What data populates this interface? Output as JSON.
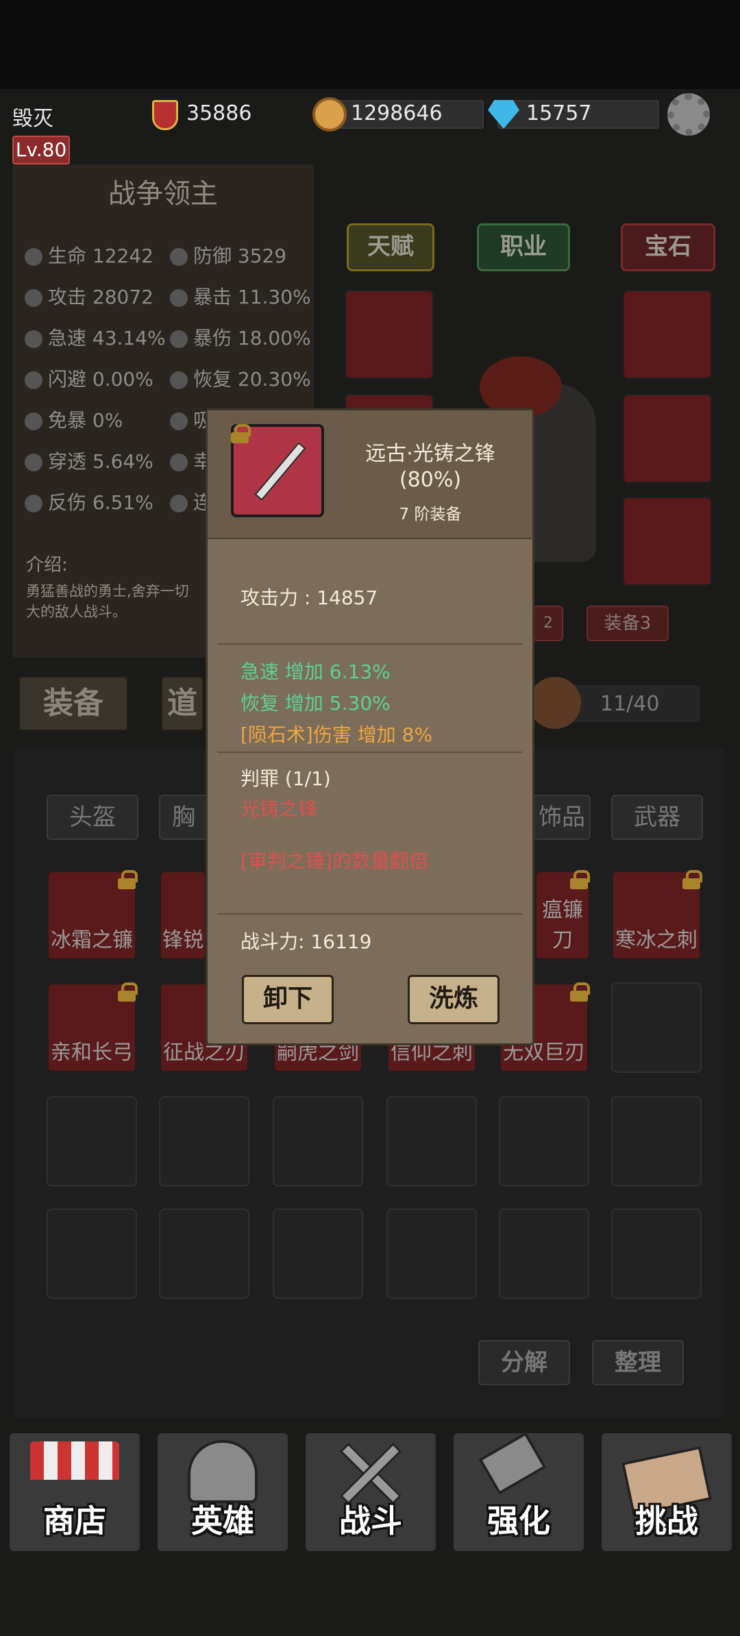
{
  "player": {
    "name": "毁灭",
    "level": "Lv.80",
    "power": "35886",
    "coins": "1298646",
    "gems": "15757"
  },
  "hero": {
    "title": "战争领主",
    "stats": [
      {
        "label": "生命 12242"
      },
      {
        "label": "防御 3529"
      },
      {
        "label": "攻击 28072"
      },
      {
        "label": "暴击 11.30%"
      },
      {
        "label": "急速 43.14%"
      },
      {
        "label": "暴伤 18.00%"
      },
      {
        "label": "闪避 0.00%"
      },
      {
        "label": "恢复 20.30%"
      },
      {
        "label": "免暴 0%"
      },
      {
        "label": "吸"
      },
      {
        "label": "穿透 5.64%"
      },
      {
        "label": "幸"
      },
      {
        "label": "反伤 6.51%"
      },
      {
        "label": "连"
      }
    ],
    "intro_label": "介绍:",
    "intro_text": "勇猛善战的勇士,舍弃一切\n大的敌人战斗。"
  },
  "hero_tabs": {
    "talent": "天赋",
    "job": "职业",
    "gem": "宝石"
  },
  "equip_tags": {
    "equip2": "2",
    "equip3": "装备3"
  },
  "inventory": {
    "tab_equip": "装备",
    "tab_items": "道",
    "count": "11/40",
    "categories": [
      "头盔",
      "胸",
      "饰品",
      "武器"
    ],
    "items": [
      {
        "name": "冰霜之镰"
      },
      {
        "name": "锋锐"
      },
      {
        "name": "瘟镰刀"
      },
      {
        "name": "寒冰之刺"
      },
      {
        "name": "亲和长弓"
      },
      {
        "name": "征战之刃"
      },
      {
        "name": "嗣虎之剑"
      },
      {
        "name": "信仰之刺"
      },
      {
        "name": "无双巨刃"
      }
    ],
    "decompose": "分解",
    "sort": "整理"
  },
  "popup": {
    "item_name": "远古·光铸之锋",
    "quality": "(80%)",
    "tier": "7 阶装备",
    "attack": "攻击力 : 14857",
    "bonuses": [
      "急速 增加 6.13%",
      "恢复 增加 5.30%",
      "[陨石术]伤害 增加 8%"
    ],
    "set_name": "判罪 (1/1)",
    "set_item": "光铸之锋",
    "set_effect": "[审判之锤]的数量翻倍",
    "combat_power": "战斗力: 16119",
    "unequip": "卸下",
    "refine": "洗炼"
  },
  "nav": [
    {
      "label": "商店"
    },
    {
      "label": "英雄"
    },
    {
      "label": "战斗"
    },
    {
      "label": "强化"
    },
    {
      "label": "挑战"
    }
  ],
  "colors": {
    "green": "#5fcf9a",
    "orange": "#f0a441",
    "red": "#e05050",
    "gold": "#e3a72f",
    "coin": "#d9a14a",
    "gem": "#3fb7e8"
  }
}
